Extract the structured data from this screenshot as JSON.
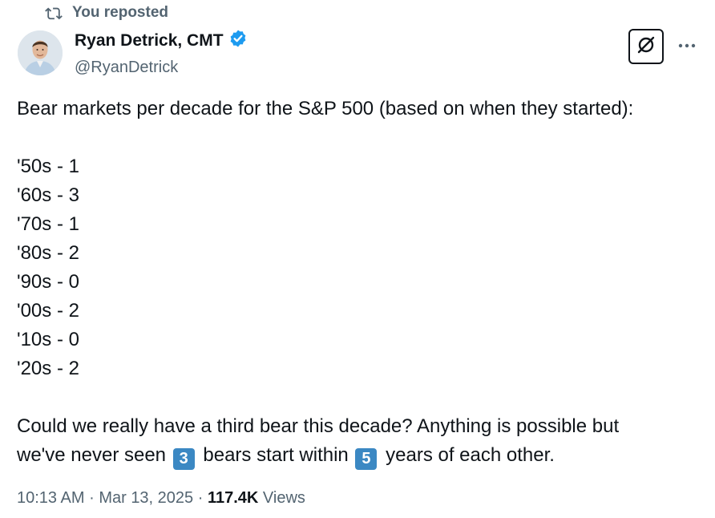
{
  "repost": {
    "label": "You reposted",
    "icon": "repost-icon"
  },
  "author": {
    "display_name": "Ryan Detrick, CMT",
    "handle": "@RyanDetrick",
    "verified_icon": "verified-badge-icon",
    "verified_color": "#1d9bf0"
  },
  "actions": {
    "grok_icon": "grok-icon",
    "more_icon": "more-icon"
  },
  "tweet": {
    "intro": "Bear markets per decade for the S&P 500 (based on when they started):",
    "decades": [
      "'50s - 1",
      "'60s - 3",
      "'70s - 1",
      "'80s - 2",
      "'90s - 0",
      "'00s - 2",
      "'10s - 0",
      "'20s - 2"
    ],
    "closing_line1": "Could we really have a third bear this decade? Anything is possible but",
    "closing_line2_a": "we've never seen",
    "keycap_a": "3",
    "closing_line2_b": "bears start within",
    "keycap_b": "5",
    "closing_line2_c": "years of each other."
  },
  "meta": {
    "time": "10:13 AM",
    "separator": "·",
    "date": "Mar 13, 2025",
    "views_count": "117.4K",
    "views_label": "Views"
  },
  "colors": {
    "text": "#0f1419",
    "secondary": "#536471",
    "keycap": "#3b88c3"
  }
}
